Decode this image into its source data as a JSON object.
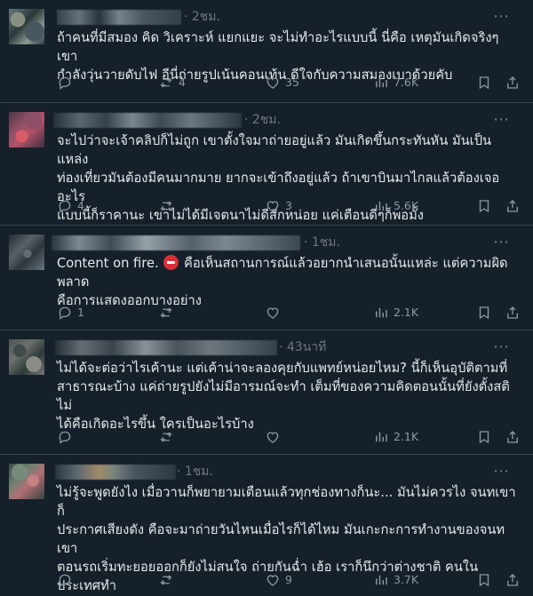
{
  "colors": {
    "background": "#15202b",
    "text": "#e7e9ea",
    "muted": "#71767b",
    "divider": "#38444d"
  },
  "posts": [
    {
      "time": "· 2ชม.",
      "content": "ถ้าคนที่มีสมอง คิด วิเคราะห์ แยกแยะ จะไม่ทำอะไรแบบนี้ นี่คือ เหตุมันเกิดจริงๆ เขา\nกำลังวุ่นวายดับไฟ อีนี่ถ่ายรูปเน้นคอนเท้น ดีใจกับความสมองเบาด้วยคับ",
      "metrics": {
        "replies": "",
        "reposts": "4",
        "likes": "35",
        "views": "7.6K"
      }
    },
    {
      "time": "· 2ชม.",
      "content": "จะไปว่าจะเจ้าคลิปก็ไม่ถูก เขาตั้งใจมาถ่ายอยู่แล้ว มันเกิดขึ้นกระทันหัน มันเป็นแหล่ง\nท่องเที่ยวมันต้องมีคนมากมาย ยากจะเข้าถึงอยู่แล้ว ถ้าเขาบินมาไกลแล้วต้องเจออะไร\nแบบนี้ก็ราคานะ เขาไม่ได้มีเจตนาไม่ดีสักหน่อย แค่เตือนดีๆก็พอมั้ง",
      "metrics": {
        "replies": "4",
        "reposts": "",
        "likes": "3",
        "views": "5.6K"
      }
    },
    {
      "time": "· 1ชม.",
      "content_prefix": "Content on fire. ",
      "emoji": "no-entry-emoji",
      "content_suffix": " คือเห็นสถานการณ์แล้วอยากนำเสนอนั้นแหล่ะ แต่ความผิดพลาด\nคือการแสดงออกบางอย่าง",
      "metrics": {
        "replies": "1",
        "reposts": "",
        "likes": "",
        "views": "2.1K"
      }
    },
    {
      "time": "· 43นาที",
      "content": "ไม่ได้จะต่อว่าไรเค้านะ แต่เค้าน่าจะลองคุยกับแพทย์หน่อยไหม? นี้ก็เห็นอุบัติตามที่\nสาธารณะบ้าง แค่ถ่ายรูปยังไม่มีอารมณ์จะทำ เต็มที่ของความคิดตอนนั้นที่ยังตั้งสติไม่\nได้คือเกิดอะไรขึ้น ใครเป็นอะไรบ้าง",
      "metrics": {
        "replies": "",
        "reposts": "",
        "likes": "",
        "views": "2.1K"
      }
    },
    {
      "time": "· 1ชม.",
      "content": "ไม่รู้จะพูดยังไง เมื่อวานก็พยายามเตือนแล้วทุกช่องทางก็นะ... มันไม่ควรไง จนทเขาก็\nประกาศเสียงดัง คือจะมาถ่ายวันไหนเมื่อไรก็ได้ไหม มันเกะกะการทำงานของจนทเขา\nตอนรถเริ่มทะยอยออกก็ยังไม่สนใจ ถ่ายกันฉ่ำ เฮ้อ เราก็นึกว่าต่างชาติ คนในประเทศทำ\nกันเสียเอง",
      "metrics": {
        "replies": "",
        "reposts": "",
        "likes": "9",
        "views": "3.7K"
      }
    }
  ]
}
